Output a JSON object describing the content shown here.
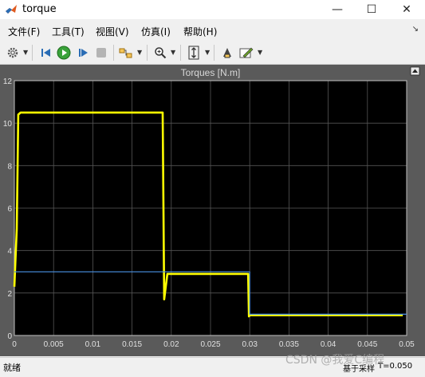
{
  "window": {
    "title": "torque",
    "minimize": "—",
    "maximize": "☐",
    "close": "✕"
  },
  "menu": {
    "items": [
      "文件(F)",
      "工具(T)",
      "视图(V)",
      "仿真(I)",
      "帮助(H)"
    ],
    "corner_arrow": "↘"
  },
  "toolbar": {
    "icons": [
      "settings-icon",
      "step-back-icon",
      "run-icon",
      "step-forward-icon",
      "stop-icon",
      "highlight-block-icon",
      "zoom-icon",
      "autoscale-icon",
      "restore-view-icon",
      "edit-icon"
    ]
  },
  "plot": {
    "title": "Torques [N.m]",
    "background": "#000000",
    "axes_color": "#c0c0c0",
    "grid_color": "#555555",
    "expand_icon": "expand-icon"
  },
  "chart_data": {
    "type": "line",
    "title": "Torques [N.m]",
    "xlabel": "",
    "ylabel": "",
    "xlim": [
      0,
      0.05
    ],
    "ylim": [
      0,
      12
    ],
    "xticks": [
      "0",
      "0.005",
      "0.01",
      "0.015",
      "0.02",
      "0.025",
      "0.03",
      "0.035",
      "0.04",
      "0.045",
      "0.05"
    ],
    "yticks": [
      "0",
      "2",
      "4",
      "6",
      "8",
      "10",
      "12"
    ],
    "grid": true,
    "series": [
      {
        "color": "#ffff00",
        "x": [
          0,
          0.0003,
          0.0005,
          0.0008,
          0.0185,
          0.0189,
          0.019,
          0.0191,
          0.0195,
          0.0295,
          0.0298,
          0.0299,
          0.03,
          0.0305,
          0.0495
        ],
        "y": [
          2.3,
          5,
          10.4,
          10.5,
          10.5,
          10.5,
          6,
          1.7,
          2.9,
          2.9,
          2.9,
          0.9,
          0.95,
          0.95,
          0.95
        ]
      },
      {
        "color": "#4a90e2",
        "x": [
          0,
          0.019,
          0.019,
          0.03,
          0.03,
          0.05
        ],
        "y": [
          3,
          3,
          3,
          3,
          1,
          1
        ]
      }
    ]
  },
  "status": {
    "left": "就绪",
    "sample_label": "基于采样",
    "time": "T=0.050"
  },
  "watermark": "CSDN @我爱C编程"
}
